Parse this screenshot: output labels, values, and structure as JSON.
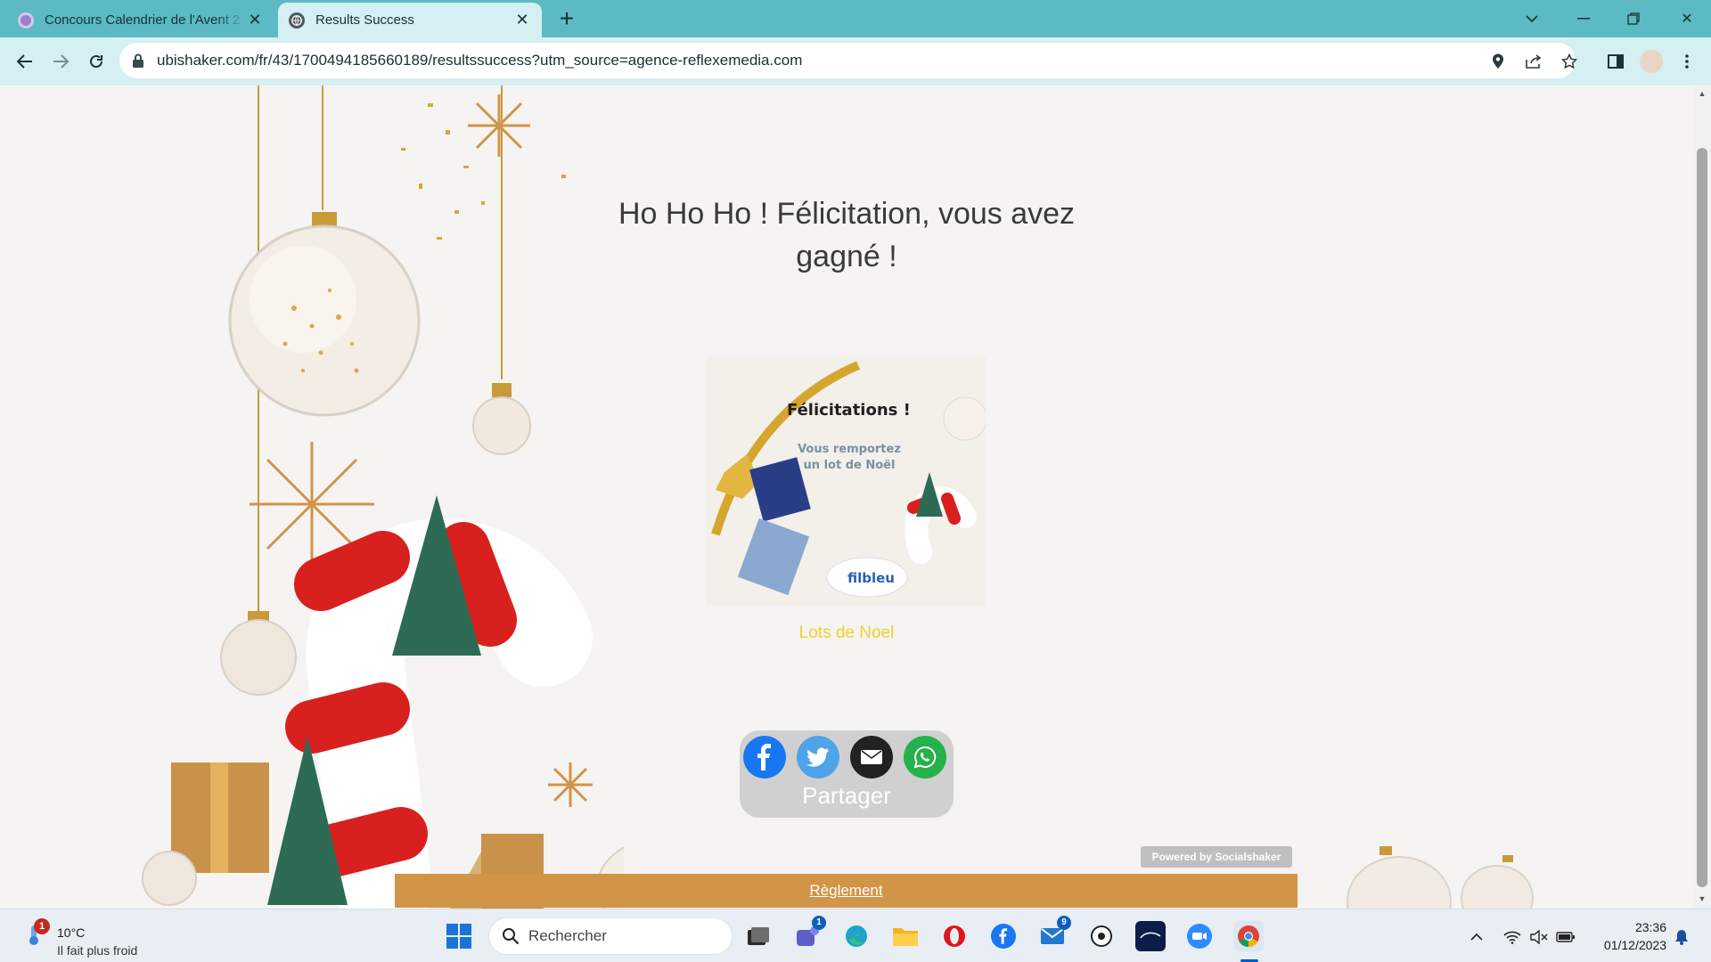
{
  "browser": {
    "tabs": [
      {
        "title": "Concours Calendrier de l'Avent 2",
        "active": false
      },
      {
        "title": "Results Success",
        "active": true
      }
    ],
    "new_tab_label": "+",
    "url": "ubishaker.com/fr/43/1700494185660189/resultssuccess?utm_source=agence-reflexemedia.com"
  },
  "page": {
    "headline": "Ho Ho Ho ! Félicitation, vous avez gagné !",
    "prize_image": {
      "title": "Félicitations !",
      "subtitle": "Vous remportez un lot de Noël",
      "brand": "filbleu"
    },
    "prize_caption": "Lots de Noel",
    "share": {
      "label": "Partager",
      "buttons": [
        "facebook",
        "twitter",
        "email",
        "whatsapp"
      ],
      "colors": {
        "facebook": "#1877f2",
        "twitter": "#4fa3e8",
        "email": "#222222",
        "whatsapp": "#25b14b"
      }
    },
    "powered_by": "Powered by Socialshaker",
    "rules_link": "Règlement",
    "caption_color": "#f4cf2d",
    "rules_bar_color": "#d29447"
  },
  "taskbar": {
    "weather": {
      "temp": "10°C",
      "desc": "Il fait plus froid",
      "badge": "1"
    },
    "search_placeholder": "Rechercher",
    "teams_badge": "1",
    "mail_badge": "9",
    "clock": {
      "time": "23:36",
      "date": "01/12/2023"
    }
  }
}
